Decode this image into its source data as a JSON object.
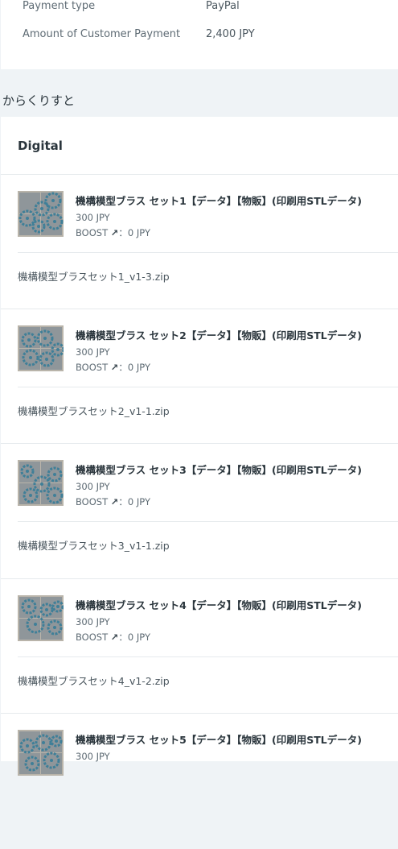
{
  "payment": {
    "rows": [
      {
        "label": "Payment type",
        "value": "PayPal"
      },
      {
        "label": "Amount of Customer Payment",
        "value": "2,400 JPY"
      }
    ]
  },
  "shop": {
    "name": "からくりすと"
  },
  "order": {
    "section_title": "Digital",
    "items": [
      {
        "title": "機構模型ブラス セット1【データ】【物販】(印刷用STLデータ)",
        "price": "300 JPY",
        "boost_label": "BOOST",
        "boost_icon": "↗",
        "boost_value": "：0 JPY",
        "file": "機構模型ブラスセット1_v1-3.zip"
      },
      {
        "title": "機構模型ブラス セット2【データ】【物販】(印刷用STLデータ)",
        "price": "300 JPY",
        "boost_label": "BOOST",
        "boost_icon": "↗",
        "boost_value": "：0 JPY",
        "file": "機構模型ブラスセット2_v1-1.zip"
      },
      {
        "title": "機構模型ブラス セット3【データ】【物販】(印刷用STLデータ)",
        "price": "300 JPY",
        "boost_label": "BOOST",
        "boost_icon": "↗",
        "boost_value": "：0 JPY",
        "file": "機構模型ブラスセット3_v1-1.zip"
      },
      {
        "title": "機構模型ブラス セット4【データ】【物販】(印刷用STLデータ)",
        "price": "300 JPY",
        "boost_label": "BOOST",
        "boost_icon": "↗",
        "boost_value": "：0 JPY",
        "file": "機構模型ブラスセット4_v1-2.zip"
      },
      {
        "title": "機構模型ブラス セット5【データ】【物販】(印刷用STLデータ)",
        "price": "300 JPY"
      }
    ]
  },
  "colors": {
    "page_bg": "#eff3f6",
    "card_bg": "#ffffff",
    "text_primary": "#2a353c",
    "text_secondary": "#5e6b74",
    "divider": "#e6eaed",
    "model_blue": "#3f7f98"
  }
}
